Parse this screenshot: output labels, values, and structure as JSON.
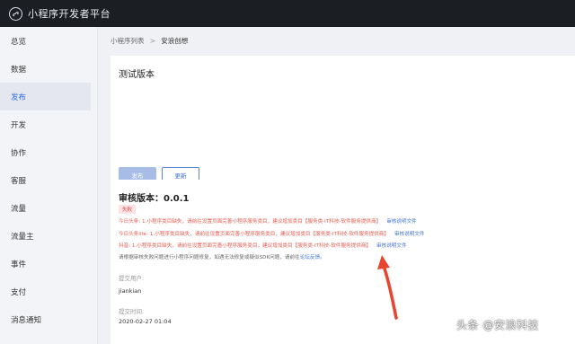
{
  "header": {
    "app_title": "小程序开发者平台",
    "logo_icon": "mini-program-logo-icon"
  },
  "sidebar": {
    "items": [
      {
        "label": "总览"
      },
      {
        "label": "数据"
      },
      {
        "label": "发布",
        "active": true
      },
      {
        "label": "开发"
      },
      {
        "label": "协作"
      },
      {
        "label": "客服"
      },
      {
        "label": "流量"
      },
      {
        "label": "流量主"
      },
      {
        "label": "事件"
      },
      {
        "label": "支付"
      },
      {
        "label": "消息通知"
      }
    ]
  },
  "breadcrumb": {
    "parent": "小程序列表",
    "separator": ">",
    "current": "安浪创想"
  },
  "test_version": {
    "title": "测试版本",
    "publish_button": "发布",
    "update_button": "更新"
  },
  "review": {
    "title": "审核版本：0.0.1",
    "status_badge": "失败",
    "reasons": [
      {
        "text": "今日头条: 1.小程序类目缺失，请前往设置页面完善小程序服务类目，建议增加类目【服务类-IT科技-软件服务提供商】",
        "link": "审核说明文件"
      },
      {
        "text": "今日头条lite: 1.小程序类目缺失，请前往设置页面完善小程序服务类目，建议增加类目【服务类-IT科技-软件服务提供商】",
        "link": "审核说明文件"
      },
      {
        "text": "抖音: 1.小程序类目缺失，请前往设置页面完善小程序服务类目，建议增加类目【服务类-IT科技-软件服务提供商】",
        "link": "审核说明文件"
      }
    ],
    "note_text": "请根据审核失败问题进行小程序问题修复，如遇无法修复或疑似SDK问题，请前往",
    "note_link": "论坛反馈。",
    "submitter_label": "提交用户:",
    "submitter_value": "jiankian",
    "submit_time_label": "提交时间:",
    "submit_time_value": "2020-02-27 01:04"
  },
  "watermark": "头条 @安浪科技",
  "colors": {
    "topbar": "#1b1f24",
    "accent": "#2d6fe0",
    "error": "#e35b4f",
    "arrow": "#e8452f"
  }
}
